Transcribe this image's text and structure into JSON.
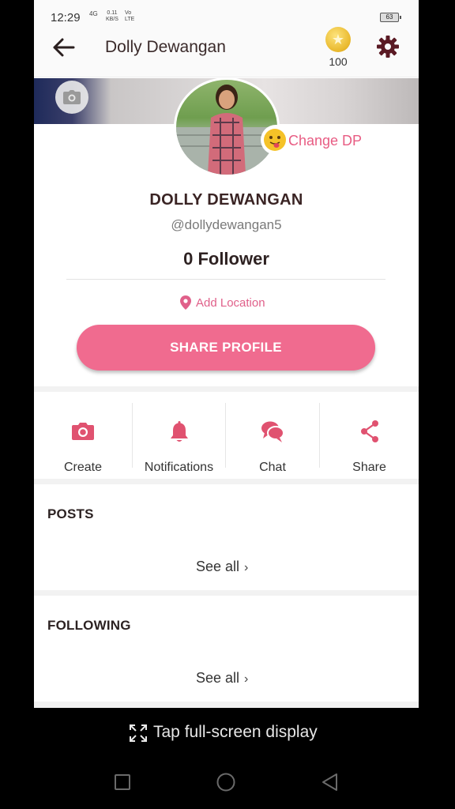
{
  "status": {
    "time": "12:29",
    "network": "4G",
    "speed_top": "0.11",
    "speed_bottom": "KB/S",
    "volte_top": "Vo",
    "volte_bottom": "LTE",
    "battery": "63"
  },
  "header": {
    "title": "Dolly Dewangan",
    "coins": "100"
  },
  "profile": {
    "change_dp": "Change DP",
    "name": "DOLLY DEWANGAN",
    "handle": "@dollydewangan5",
    "followers": "0 Follower",
    "add_location": "Add Location",
    "share_button": "SHARE PROFILE"
  },
  "actions": [
    {
      "label": "Create",
      "icon": "camera-icon"
    },
    {
      "label": "Notifications",
      "icon": "bell-icon"
    },
    {
      "label": "Chat",
      "icon": "chat-icon"
    },
    {
      "label": "Share",
      "icon": "share-icon"
    }
  ],
  "sections": {
    "posts": {
      "title": "POSTS",
      "see_all": "See all"
    },
    "following": {
      "title": "FOLLOWING",
      "see_all": "See all"
    }
  },
  "system": {
    "fullscreen_hint": "Tap full-screen display"
  },
  "colors": {
    "accent": "#f06b8f",
    "accent_text": "#e0608a",
    "icon": "#e05270"
  }
}
